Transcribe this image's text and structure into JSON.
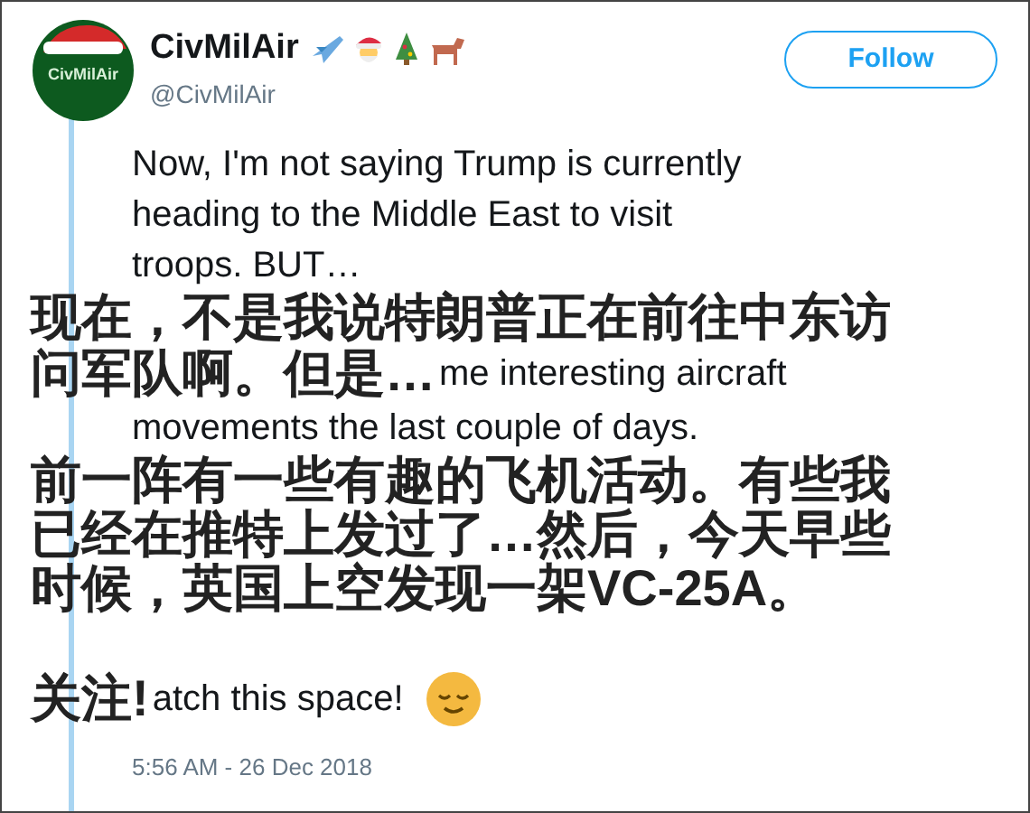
{
  "author": {
    "avatar_text": "CivMilAir",
    "name": "CivMilAir",
    "handle": "@CivMilAir"
  },
  "follow_button": "Follow",
  "rows": [
    {
      "kind": "text",
      "en": "Now, I'm not saying Trump is currently"
    },
    {
      "kind": "text",
      "en": "heading to the Middle East to visit"
    },
    {
      "kind": "text",
      "en": "troops. BUT…"
    },
    {
      "kind": "subtitle",
      "zh": "现在，不是我说特朗普正在前往中东访"
    },
    {
      "kind": "overlay",
      "zh": "问军队啊。但是…",
      "en": "me interesting aircraft"
    },
    {
      "kind": "text",
      "en": "movements the last couple of days."
    },
    {
      "kind": "subtitle",
      "zh": "前一阵有一些有趣的飞机活动。有些我"
    },
    {
      "kind": "subtitle",
      "zh": "已经在推特上发过了…然后，今天早些"
    },
    {
      "kind": "subtitle",
      "zh": "时候，英国上空发现一架VC-25A。"
    },
    {
      "kind": "overlay",
      "zh": "关注!",
      "en": "atch this space!"
    }
  ],
  "timestamp": "5:56 AM - 26 Dec 2018"
}
